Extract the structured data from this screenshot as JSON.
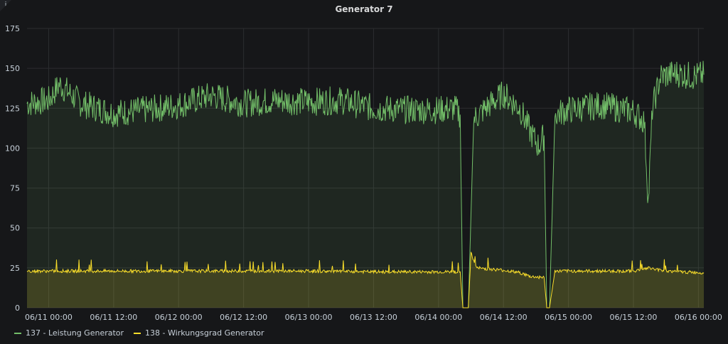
{
  "panel": {
    "title": "Generator 7",
    "info_icon": "info-icon"
  },
  "colors": {
    "series1": "#73bf69",
    "series2": "#fade2a",
    "grid": "#2c2d30",
    "axis_text": "#c7d0d9"
  },
  "chart_data": {
    "type": "line",
    "title": "Generator 7",
    "xlabel": "",
    "ylabel": "",
    "ylim": [
      0,
      175
    ],
    "yticks": [
      0,
      25,
      50,
      75,
      100,
      125,
      150,
      175
    ],
    "xlim": [
      "06/10 20:00",
      "06/16 01:00"
    ],
    "xticks": [
      "06/11 00:00",
      "06/11 12:00",
      "06/12 00:00",
      "06/12 12:00",
      "06/13 00:00",
      "06/13 12:00",
      "06/14 00:00",
      "06/14 12:00",
      "06/15 00:00",
      "06/15 12:00",
      "06/16 00:00"
    ],
    "grid": true,
    "legend_position": "bottom-left",
    "area_fill": true,
    "series": [
      {
        "name": "137 - Leistung Generator",
        "color": "#73bf69",
        "points": [
          [
            "06/10 20:00",
            128
          ],
          [
            "06/11 00:00",
            130
          ],
          [
            "06/11 02:00",
            140
          ],
          [
            "06/11 06:00",
            128
          ],
          [
            "06/11 12:00",
            122
          ],
          [
            "06/11 18:00",
            124
          ],
          [
            "06/12 00:00",
            127
          ],
          [
            "06/12 06:00",
            133
          ],
          [
            "06/12 12:00",
            128
          ],
          [
            "06/12 18:00",
            130
          ],
          [
            "06/13 00:00",
            129
          ],
          [
            "06/13 06:00",
            130
          ],
          [
            "06/13 12:00",
            125
          ],
          [
            "06/13 18:00",
            124
          ],
          [
            "06/14 00:00",
            124
          ],
          [
            "06/14 03:00",
            125
          ],
          [
            "06/14 04:00",
            121
          ],
          [
            "06/14 04:30",
            0
          ],
          [
            "06/14 05:30",
            0
          ],
          [
            "06/14 06:30",
            118
          ],
          [
            "06/14 09:00",
            126
          ],
          [
            "06/14 12:00",
            134
          ],
          [
            "06/14 15:00",
            125
          ],
          [
            "06/14 17:00",
            110
          ],
          [
            "06/14 18:30",
            101
          ],
          [
            "06/14 19:30",
            108
          ],
          [
            "06/14 20:00",
            0
          ],
          [
            "06/14 20:30",
            0
          ],
          [
            "06/14 21:30",
            121
          ],
          [
            "06/15 00:00",
            124
          ],
          [
            "06/15 06:00",
            127
          ],
          [
            "06/15 12:00",
            123
          ],
          [
            "06/15 14:00",
            117
          ],
          [
            "06/15 14:45",
            66
          ],
          [
            "06/15 15:30",
            125
          ],
          [
            "06/15 17:00",
            145
          ],
          [
            "06/15 20:00",
            147
          ],
          [
            "06/15 23:00",
            145
          ],
          [
            "06/16 01:00",
            146
          ]
        ]
      },
      {
        "name": "138 - Wirkungsgrad Generator",
        "color": "#fade2a",
        "points": [
          [
            "06/10 20:00",
            23
          ],
          [
            "06/11 12:00",
            23
          ],
          [
            "06/12 00:00",
            23
          ],
          [
            "06/12 12:00",
            23
          ],
          [
            "06/13 00:00",
            23
          ],
          [
            "06/13 12:00",
            22.5
          ],
          [
            "06/14 00:00",
            22.5
          ],
          [
            "06/14 04:00",
            22.5
          ],
          [
            "06/14 04:30",
            0
          ],
          [
            "06/14 05:30",
            0
          ],
          [
            "06/14 06:00",
            34
          ],
          [
            "06/14 07:00",
            25
          ],
          [
            "06/14 12:00",
            23.5
          ],
          [
            "06/14 15:00",
            22
          ],
          [
            "06/14 17:00",
            19.5
          ],
          [
            "06/14 19:30",
            19
          ],
          [
            "06/14 20:00",
            0
          ],
          [
            "06/14 20:30",
            0
          ],
          [
            "06/14 21:30",
            23
          ],
          [
            "06/15 00:00",
            23
          ],
          [
            "06/15 12:00",
            23
          ],
          [
            "06/15 15:00",
            25
          ],
          [
            "06/15 16:00",
            24
          ],
          [
            "06/15 20:00",
            22.5
          ],
          [
            "06/16 01:00",
            22
          ]
        ]
      }
    ]
  }
}
